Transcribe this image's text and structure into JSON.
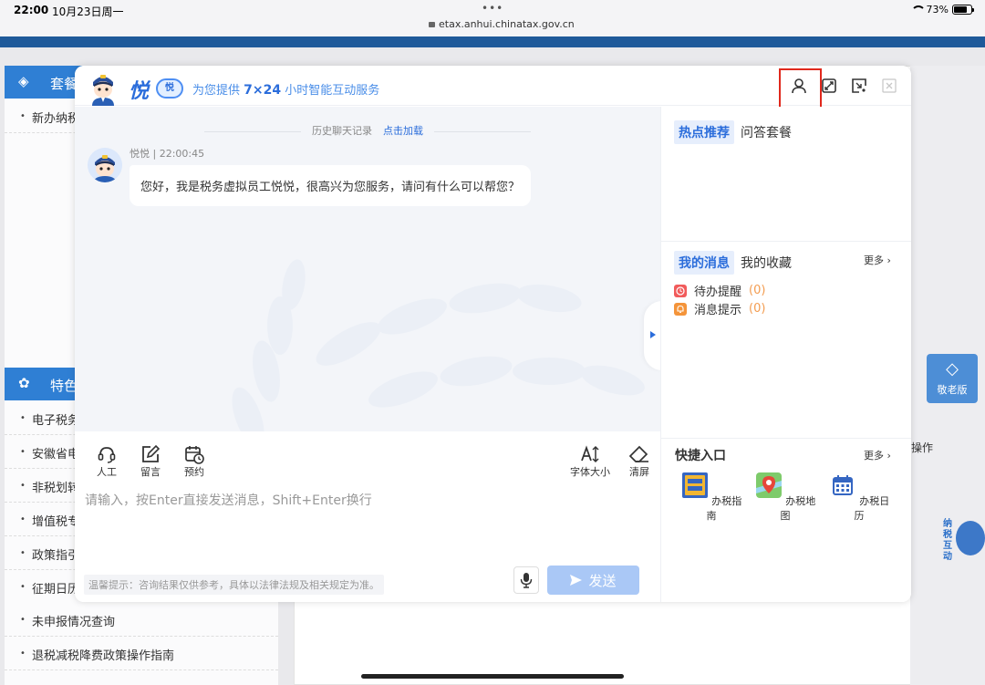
{
  "status_bar": {
    "time": "22:00",
    "date": "10月23日周一",
    "url": "etax.anhui.chinatax.gov.cn",
    "battery": "73%",
    "dots": "•••"
  },
  "background": {
    "section1_title": "套餐",
    "section1_items": [
      "新办纳税"
    ],
    "section2_title": "特色",
    "section2_items": [
      "电子税务",
      "安徽省电",
      "非税划转",
      "增值税专",
      "政策指引",
      "征期日历",
      "未申报情况查询",
      "退税减税降费政策操作指南"
    ],
    "right_text": "操作",
    "elder_label": "敬老版",
    "side_mascot_text": "纳税互动"
  },
  "dialog": {
    "brand_name": "悦",
    "brand_badge": "悦",
    "slogan_prefix": "为您提供",
    "slogan_highlight": "7×24",
    "slogan_suffix": "小时智能互动服务",
    "history_label": "历史聊天记录",
    "history_load": "点击加载",
    "message": {
      "sender": "悦悦 | 22:00:45",
      "text": "您好，我是税务虚拟员工悦悦，很高兴为您服务，请问有什么可以帮您？"
    },
    "tools_left": [
      {
        "label": "人工",
        "icon": "headset-icon"
      },
      {
        "label": "留言",
        "icon": "edit-icon"
      },
      {
        "label": "预约",
        "icon": "calendar-clock-icon"
      }
    ],
    "tools_right": [
      {
        "label": "字体大小",
        "icon": "font-size-icon"
      },
      {
        "label": "清屏",
        "icon": "eraser-icon"
      }
    ],
    "input_placeholder": "请输入，按Enter直接发送消息，Shift+Enter换行",
    "tip": "温馨提示：咨询结果仅供参考，具体以法律法规及相关规定为准。",
    "send_label": "发送",
    "right_panel": {
      "hot_tab_active": "热点推荐",
      "hot_tab": "问答套餐",
      "msg_tab_active": "我的消息",
      "msg_tab": "我的收藏",
      "more1": "更多",
      "todo_label": "待办提醒",
      "todo_count": "(0)",
      "notice_label": "消息提示",
      "notice_count": "(0)",
      "quick_title": "快捷入口",
      "more2": "更多",
      "quick_items": [
        {
          "label": "办税指南",
          "icon": "tax-guide-icon"
        },
        {
          "label": "办税地图",
          "icon": "map-pin-icon"
        },
        {
          "label": "办税日历",
          "icon": "calendar-icon"
        }
      ]
    }
  },
  "colors": {
    "brand_blue": "#2b6ddb",
    "highlight_red": "#e0281c",
    "send_disabled": "#aac8f6",
    "sidebar_head": "#2f7fd4"
  }
}
